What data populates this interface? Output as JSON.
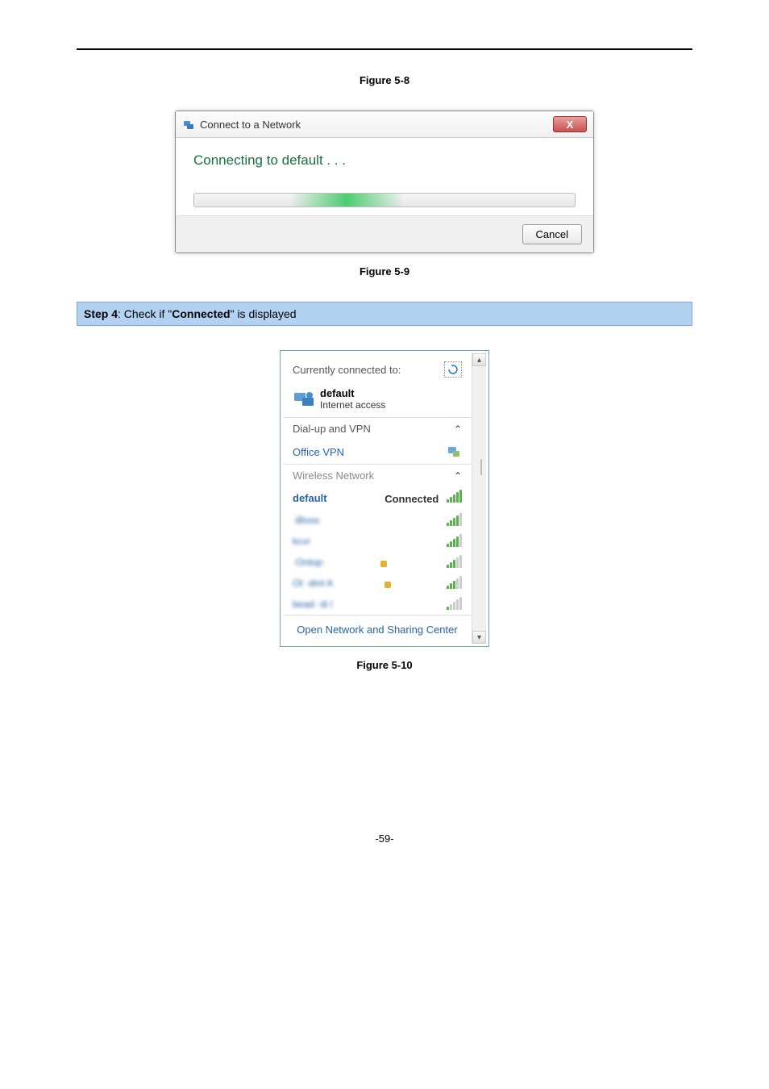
{
  "fig1_caption": "Figure 5-8",
  "dialog1": {
    "title": "Connect to a Network",
    "message": "Connecting to default . . .",
    "cancel": "Cancel",
    "close": "X"
  },
  "fig2_caption": "Figure 5-9",
  "step": {
    "prefix": "Step 4",
    "mid1": ": Check if \"",
    "bold": "Connected",
    "mid2": "\" is displayed"
  },
  "flyout": {
    "currently": "Currently connected to:",
    "conn_name": "default",
    "conn_sub": "Internet access",
    "dialup_header": "Dial-up and VPN",
    "vpn_name": "Office VPN",
    "wireless_header": "Wireless Network",
    "wifi_connected_name": "default",
    "wifi_connected_status": "Connected",
    "open_link": "Open Network and Sharing Center"
  },
  "fig3_caption": "Figure 5-10",
  "page_num": "-59-"
}
